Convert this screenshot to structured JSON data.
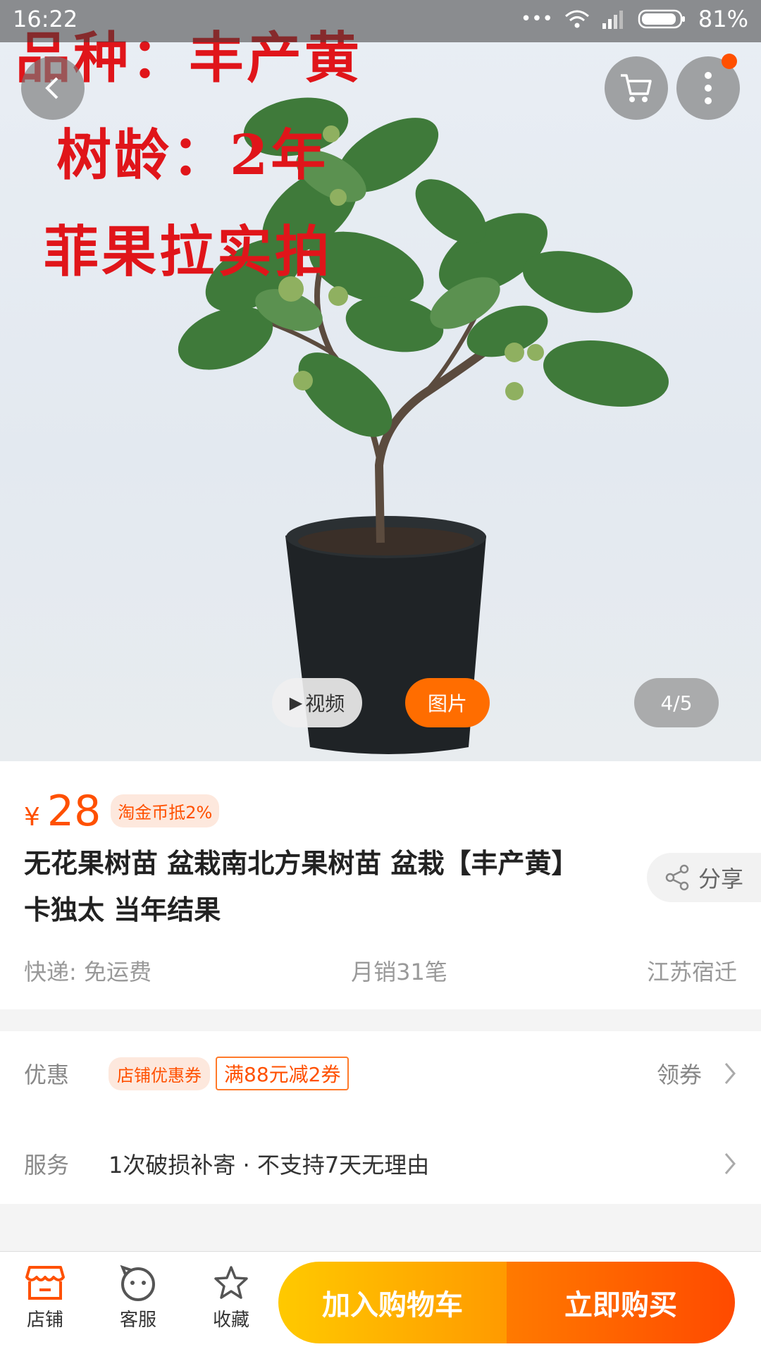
{
  "status_bar": {
    "time": "16:22",
    "dots": "•••",
    "battery": "81%"
  },
  "hero": {
    "overlay_lines": [
      "品种：丰产黄",
      "树龄：2年",
      "菲果拉实拍"
    ],
    "video_label": "视频",
    "image_label": "图片",
    "counter": "4/5"
  },
  "product": {
    "currency": "¥",
    "price": "28",
    "coin_tag": "淘金币抵2%",
    "title": "无花果树苗  盆栽南北方果树苗  盆栽【丰产黄】卡独太  当年结果",
    "share_label": "分享",
    "shipping": "快递: 免运费",
    "monthly_sales": "月销31笔",
    "location": "江苏宿迁"
  },
  "promotions": {
    "label": "优惠",
    "shop_tag": "店铺优惠券",
    "coupon": "满88元减2券",
    "action": "领券"
  },
  "service": {
    "label": "服务",
    "items": "1次破损补寄 · 不支持7天无理由"
  },
  "bottom_bar": {
    "shop": "店铺",
    "support": "客服",
    "favorite": "收藏",
    "add_to_cart": "加入购物车",
    "buy_now": "立即购买"
  },
  "colors": {
    "accent": "#ff5000",
    "cart_start": "#ffc400",
    "buy_end": "#ff4a00"
  }
}
